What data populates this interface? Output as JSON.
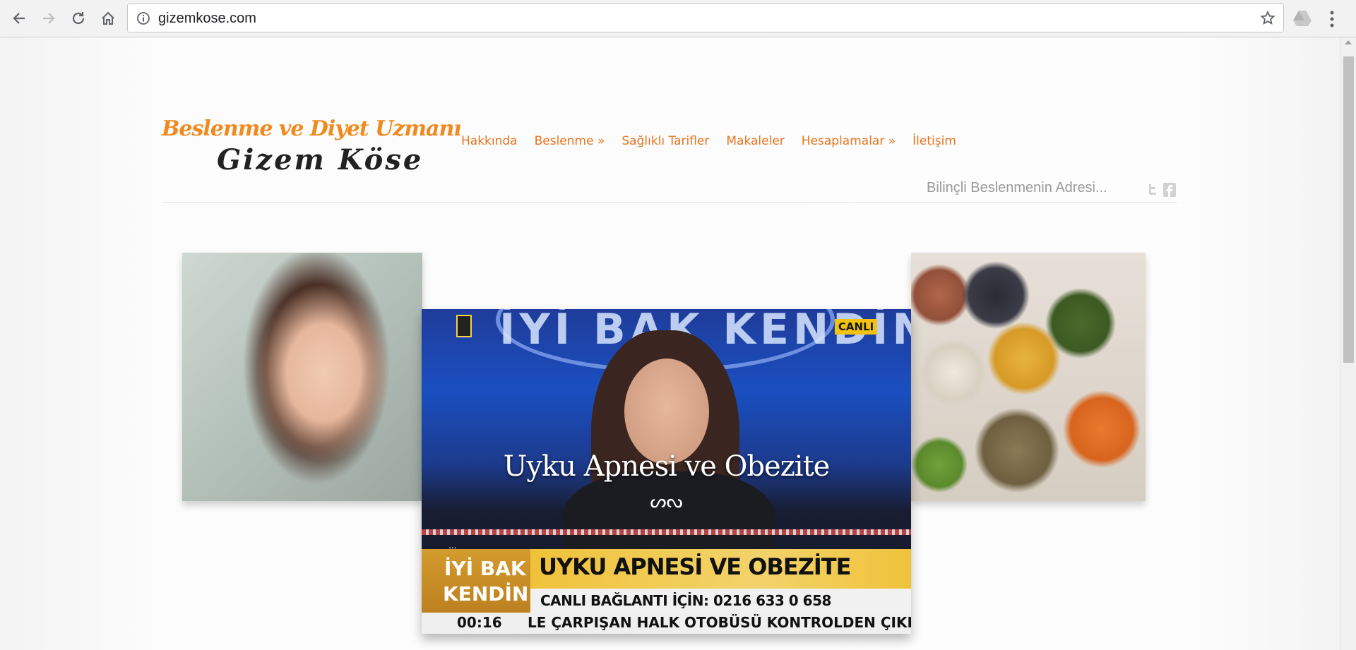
{
  "browser": {
    "url": "gizemkose.com",
    "icons": [
      "back-icon",
      "forward-icon",
      "reload-icon",
      "home-icon",
      "info-icon",
      "star-icon",
      "drive-icon",
      "menu-icon"
    ]
  },
  "site": {
    "logo_line1": "Beslenme ve Diyet Uzmanı",
    "logo_line2": "Gizem Köse",
    "menu": [
      "Hakkında",
      "Beslenme »",
      "Sağlıklı Tarifler",
      "Makaleler",
      "Hesaplamalar »",
      "İletişim"
    ],
    "tagline": "Bilinçli Beslenmenin Adresi...",
    "accent_color": "#e8741d"
  },
  "slider": {
    "caption": "Uyku Apnesi ve Obezite",
    "ornament": "ᔕᔓ",
    "more": "...",
    "tv": {
      "top_text": "İYİ BAK KENDİNE",
      "live_badge": "CANLI",
      "brand_line1": "İYİ BAK",
      "brand_line2": "KENDİNE",
      "headline": "UYKU APNESİ VE OBEZİTE",
      "phone_line": "CANLI BAĞLANTI İÇİN:  0216 633 0 658",
      "time": "00:16",
      "ticker": "LE ÇARPIŞAN HALK OTOBÜSÜ KONTROLDEN ÇIKIP İNŞAAT"
    }
  }
}
